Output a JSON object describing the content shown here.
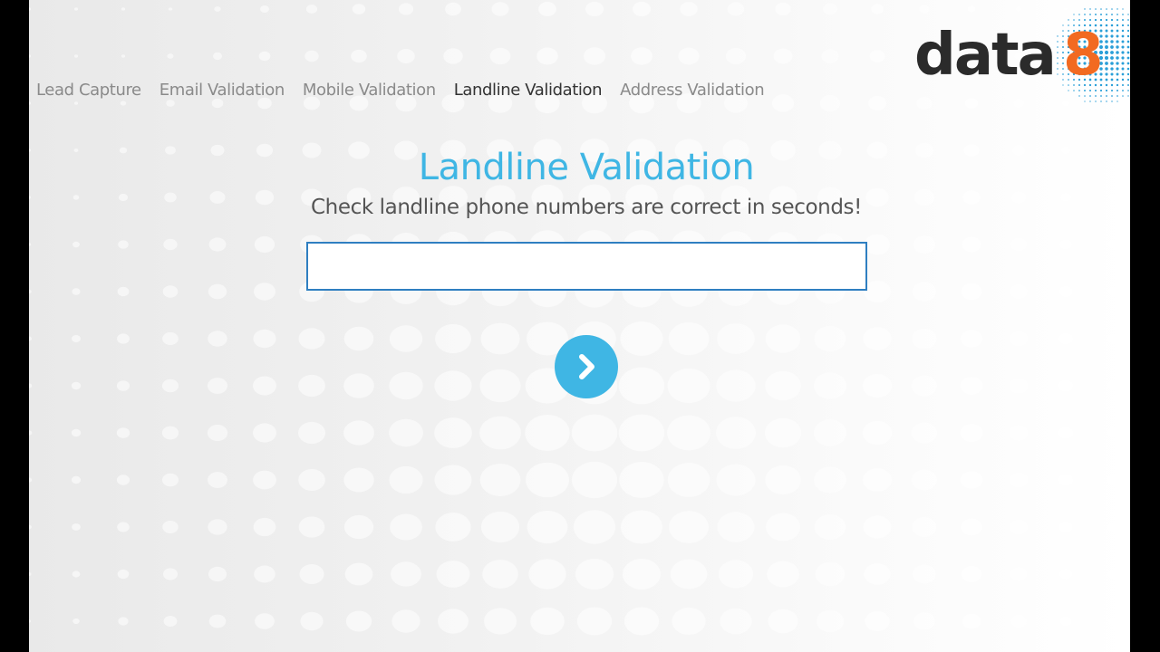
{
  "nav": {
    "items": [
      {
        "label": "Lead Capture",
        "active": false
      },
      {
        "label": "Email Validation",
        "active": false
      },
      {
        "label": "Mobile Validation",
        "active": false
      },
      {
        "label": "Landline Validation",
        "active": true
      },
      {
        "label": "Address Validation",
        "active": false
      }
    ]
  },
  "logo": {
    "text": "data8",
    "colors": {
      "letters": "#2b2b2b",
      "digit": "#f26a21",
      "globe": "#2a9fd8"
    }
  },
  "main": {
    "title": "Landline Validation",
    "subtitle": "Check landline phone numbers are correct in seconds!",
    "phone_input": {
      "value": "",
      "placeholder": ""
    },
    "submit_icon": "chevron-right-icon"
  },
  "colors": {
    "accent": "#3fb6e4",
    "input_border": "#2f7fc1",
    "nav_text": "#8a8a8a",
    "nav_active": "#333333"
  }
}
